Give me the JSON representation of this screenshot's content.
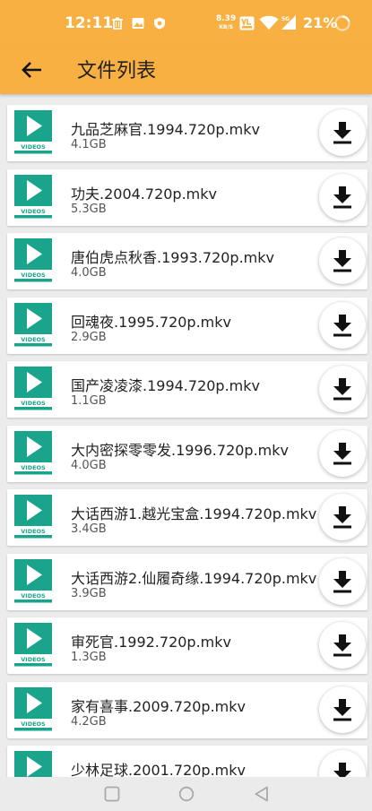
{
  "status_bar": {
    "time": "12:11",
    "net_speed_value": "8.39",
    "net_speed_unit": "KB/S",
    "battery": "21%",
    "icons": [
      "clean-icon",
      "gallery-icon",
      "shield-icon",
      "volte-icon",
      "wifi-icon",
      "signal-icon",
      "battery-ring-icon"
    ]
  },
  "app_bar": {
    "title": "文件列表",
    "back_icon": "arrow-left-icon"
  },
  "thumbnail_label": "VIDEOS",
  "files": [
    {
      "name": "九品芝麻官.1994.720p.mkv",
      "size": "4.1GB"
    },
    {
      "name": "功夫.2004.720p.mkv",
      "size": "5.3GB"
    },
    {
      "name": "唐伯虎点秋香.1993.720p.mkv",
      "size": "4.0GB"
    },
    {
      "name": "回魂夜.1995.720p.mkv",
      "size": "2.9GB"
    },
    {
      "name": "国产凌凌漆.1994.720p.mkv",
      "size": "1.1GB"
    },
    {
      "name": "大内密探零零发.1996.720p.mkv",
      "size": "4.0GB"
    },
    {
      "name": "大话西游1.越光宝盒.1994.720p.mkv",
      "size": "3.4GB"
    },
    {
      "name": "大话西游2.仙履奇缘.1994.720p.mkv",
      "size": "3.9GB"
    },
    {
      "name": "审死官.1992.720p.mkv",
      "size": "1.3GB"
    },
    {
      "name": "家有喜事.2009.720p.mkv",
      "size": "4.2GB"
    },
    {
      "name": "少林足球.2001.720p.mkv",
      "size": ""
    }
  ],
  "colors": {
    "accent": "#f7b041",
    "thumbnail": "#1aa48b"
  },
  "nav_bar": {
    "buttons": [
      "recents-icon",
      "home-icon",
      "back-triangle-icon"
    ]
  }
}
